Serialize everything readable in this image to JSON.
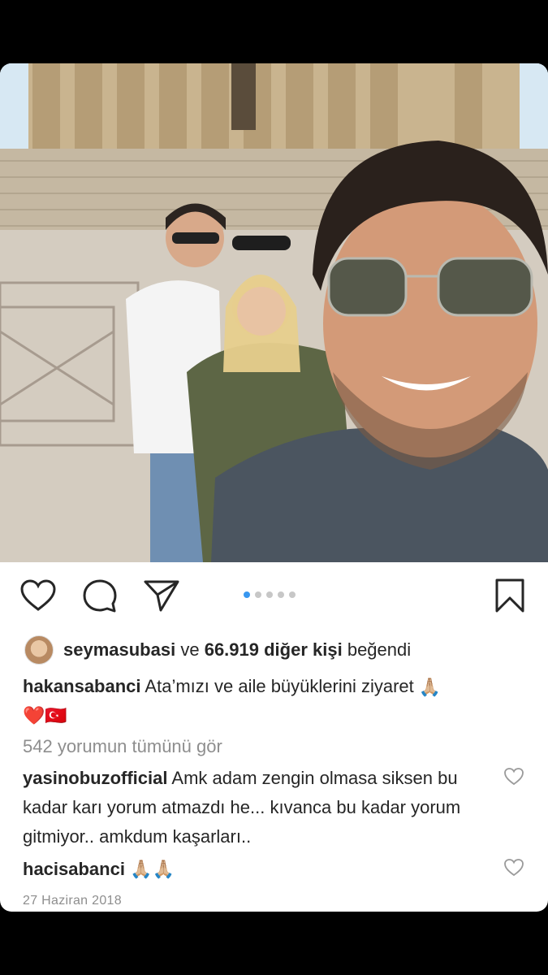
{
  "post": {
    "carousel": {
      "count": 5,
      "active_index": 0
    },
    "likes": {
      "user": "seymasubasi",
      "connector": "ve",
      "others": "66.919 diğer kişi",
      "suffix": "beğendi"
    },
    "caption": {
      "author": "hakansabanci",
      "text": "Ata’mızı ve aile büyüklerini ziyaret",
      "emoji_pray": "🙏🏼",
      "emoji_line": "❤️🇹🇷"
    },
    "view_all_comments": "542 yorumun tümünü gör",
    "comments": [
      {
        "user": "yasinobuzofficial",
        "text": "Amk adam zengin olmasa siksen bu kadar karı yorum atmazdı he... kıvanca bu kadar yorum gitmiyor.. amkdum kaşarları.."
      },
      {
        "user": "hacisabanci",
        "text": "🙏🏼🙏🏼"
      }
    ],
    "date": "27 Haziran 2018"
  },
  "icons": {
    "like": "heart-icon",
    "comment": "comment-bubble-icon",
    "share": "paper-plane-icon",
    "save": "bookmark-icon"
  },
  "colors": {
    "carousel_active": "#3897f0",
    "carousel_inactive": "#c7c7c7",
    "muted_text": "#8e8e8e"
  }
}
